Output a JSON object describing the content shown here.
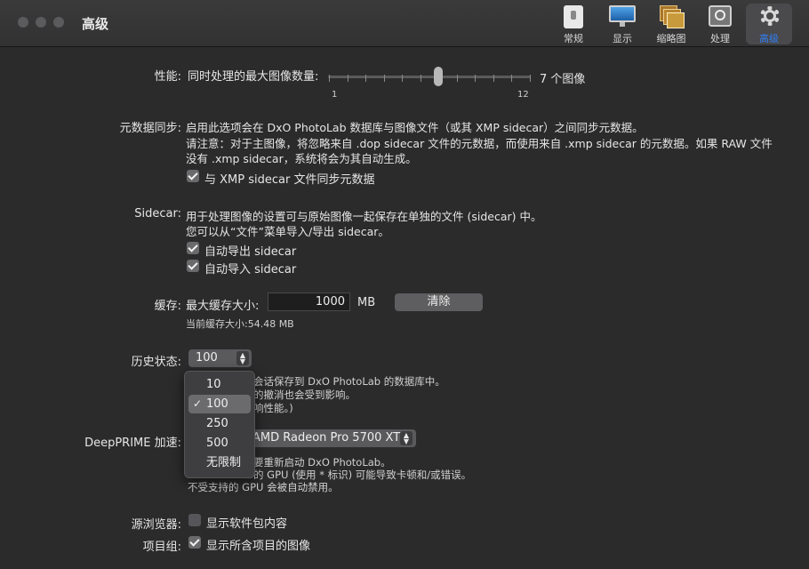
{
  "window": {
    "title": "高级"
  },
  "toolbar": {
    "items": [
      {
        "label": "常规"
      },
      {
        "label": "显示"
      },
      {
        "label": "缩略图"
      },
      {
        "label": "处理"
      },
      {
        "label": "高级"
      }
    ]
  },
  "performance": {
    "label": "性能:",
    "text": "同时处理的最大图像数量:",
    "value_text": "7 个图像",
    "min_label": "1",
    "max_label": "12",
    "value": 7,
    "min": 1,
    "max": 12
  },
  "metadata": {
    "label": "元数据同步:",
    "line1": "启用此选项会在 DxO PhotoLab 数据库与图像文件（或其 XMP sidecar）之间同步元数据。",
    "line2": "请注意：对于主图像，将忽略来自 .dop sidecar 文件的元数据，而使用来自 .xmp sidecar 的元数据。如果 RAW 文件",
    "line3": "没有 .xmp sidecar，系统将会为其自动生成。",
    "checkbox_label": "与 XMP sidecar 文件同步元数据"
  },
  "sidecar": {
    "label": "Sidecar:",
    "line1": "用于处理图像的设置可与原始图像一起保存在单独的文件 (sidecar) 中。",
    "line2": "您可以从“文件”菜单导入/导出 sidecar。",
    "export_label": "自动导出 sidecar",
    "import_label": "自动导入 sidecar"
  },
  "cache": {
    "label": "缓存:",
    "text": "最大缓存大小:",
    "value": "1000",
    "unit": "MB",
    "clear_button": "清除",
    "current": "当前缓存大小:54.48 MB"
  },
  "history": {
    "label": "历史状态:",
    "value": "100",
    "note1": "会话保存到 DxO PhotoLab 的数据库中。",
    "note2": "的撤消也会受到影响。",
    "note3": "响性能。)",
    "options": [
      "10",
      "100",
      "250",
      "500",
      "无限制"
    ],
    "selected": "100"
  },
  "deepprime": {
    "label": "DeepPRIME 加速:",
    "value": "AMD Radeon Pro 5700 XT)",
    "note1": "要重新启动 DxO PhotoLab。",
    "note2": "的 GPU (使用 * 标识) 可能导致卡顿和/或错误。",
    "note3": "不受支持的 GPU 会被自动禁用。"
  },
  "source_browser": {
    "label": "源浏览器:",
    "checkbox_label": "显示软件包内容"
  },
  "project_group": {
    "label": "项目组:",
    "checkbox_label": "显示所含项目的图像"
  }
}
